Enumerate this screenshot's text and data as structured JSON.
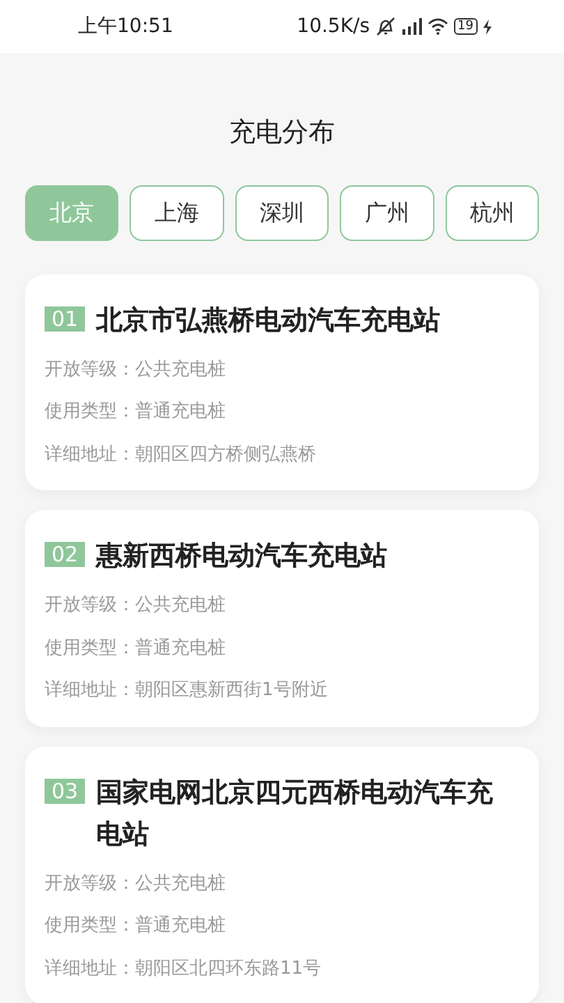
{
  "status_bar": {
    "time": "上午10:51",
    "speed": "10.5K/s",
    "battery": "19"
  },
  "title": "充电分布",
  "tabs": [
    {
      "label": "北京",
      "selected": true
    },
    {
      "label": "上海",
      "selected": false
    },
    {
      "label": "深圳",
      "selected": false
    },
    {
      "label": "广州",
      "selected": false
    },
    {
      "label": "杭州",
      "selected": false
    }
  ],
  "stations": [
    {
      "number": "01",
      "name": "北京市弘燕桥电动汽车充电站",
      "details": [
        "开放等级：公共充电桩",
        "使用类型：普通充电桩",
        "详细地址：朝阳区四方桥侧弘燕桥"
      ]
    },
    {
      "number": "02",
      "name": "惠新西桥电动汽车充电站",
      "details": [
        "开放等级：公共充电桩",
        "使用类型：普通充电桩",
        "详细地址：朝阳区惠新西街1号附近"
      ]
    },
    {
      "number": "03",
      "name": "国家电网北京四元西桥电动汽车充电站",
      "details": [
        "开放等级：公共充电桩",
        "使用类型：普通充电桩",
        "详细地址：朝阳区北四环东路11号"
      ]
    }
  ]
}
